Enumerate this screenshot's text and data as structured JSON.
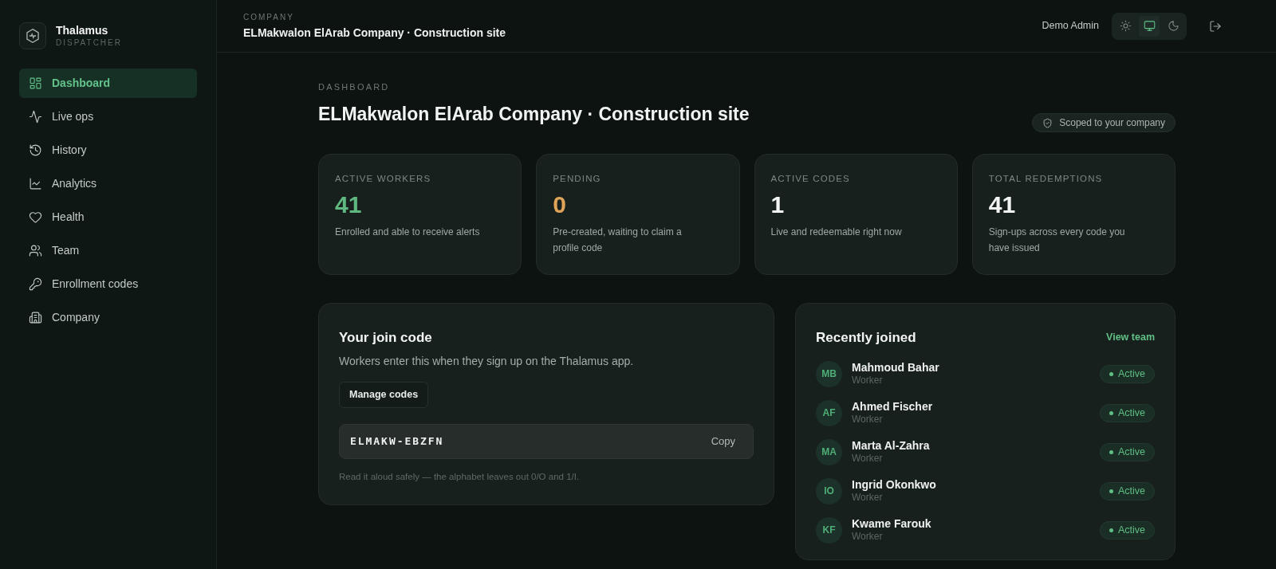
{
  "brand": {
    "name": "Thalamus",
    "subtitle": "DISPATCHER"
  },
  "sidebar": {
    "items": [
      {
        "label": "Dashboard",
        "selected": true
      },
      {
        "label": "Live ops",
        "selected": false
      },
      {
        "label": "History",
        "selected": false
      },
      {
        "label": "Analytics",
        "selected": false
      },
      {
        "label": "Health",
        "selected": false
      },
      {
        "label": "Team",
        "selected": false
      },
      {
        "label": "Enrollment codes",
        "selected": false
      },
      {
        "label": "Company",
        "selected": false
      }
    ]
  },
  "header": {
    "eyebrow": "COMPANY",
    "title": "ELMakwalon ElArab Company · Construction site",
    "user": "Demo Admin",
    "theme_options": [
      {
        "selected": false
      },
      {
        "selected": true
      },
      {
        "selected": false
      }
    ]
  },
  "page": {
    "eyebrow": "DASHBOARD",
    "title": "ELMakwalon ElArab Company · Construction site",
    "scope_badge": "Scoped to your company"
  },
  "stats": [
    {
      "label": "ACTIVE WORKERS",
      "value": "41",
      "color": "#5fb87f",
      "caption": "Enrolled and able to receive alerts"
    },
    {
      "label": "PENDING",
      "value": "0",
      "color": "#e0a458",
      "caption": "Pre-created, waiting to claim a profile code"
    },
    {
      "label": "ACTIVE CODES",
      "value": "1",
      "color": "#f2f4f3",
      "caption": "Live and redeemable right now"
    },
    {
      "label": "TOTAL REDEMPTIONS",
      "value": "41",
      "color": "#f2f4f3",
      "caption": "Sign-ups across every code you have issued"
    }
  ],
  "join_code": {
    "title": "Your join code",
    "description": "Workers enter this when they sign up on the Thalamus app.",
    "manage_button": "Manage codes",
    "code": "ELMAKW-EBZFN",
    "copy_button": "Copy",
    "note": "Read it aloud safely — the alphabet leaves out 0/O and 1/I."
  },
  "recently_joined": {
    "title": "Recently joined",
    "link": "View team",
    "members": [
      {
        "initials": "MB",
        "name": "Mahmoud Bahar",
        "role": "Worker",
        "status": "Active"
      },
      {
        "initials": "AF",
        "name": "Ahmed Fischer",
        "role": "Worker",
        "status": "Active"
      },
      {
        "initials": "MA",
        "name": "Marta Al-Zahra",
        "role": "Worker",
        "status": "Active"
      },
      {
        "initials": "IO",
        "name": "Ingrid Okonkwo",
        "role": "Worker",
        "status": "Active"
      },
      {
        "initials": "KF",
        "name": "Kwame Farouk",
        "role": "Worker",
        "status": "Active"
      }
    ]
  }
}
